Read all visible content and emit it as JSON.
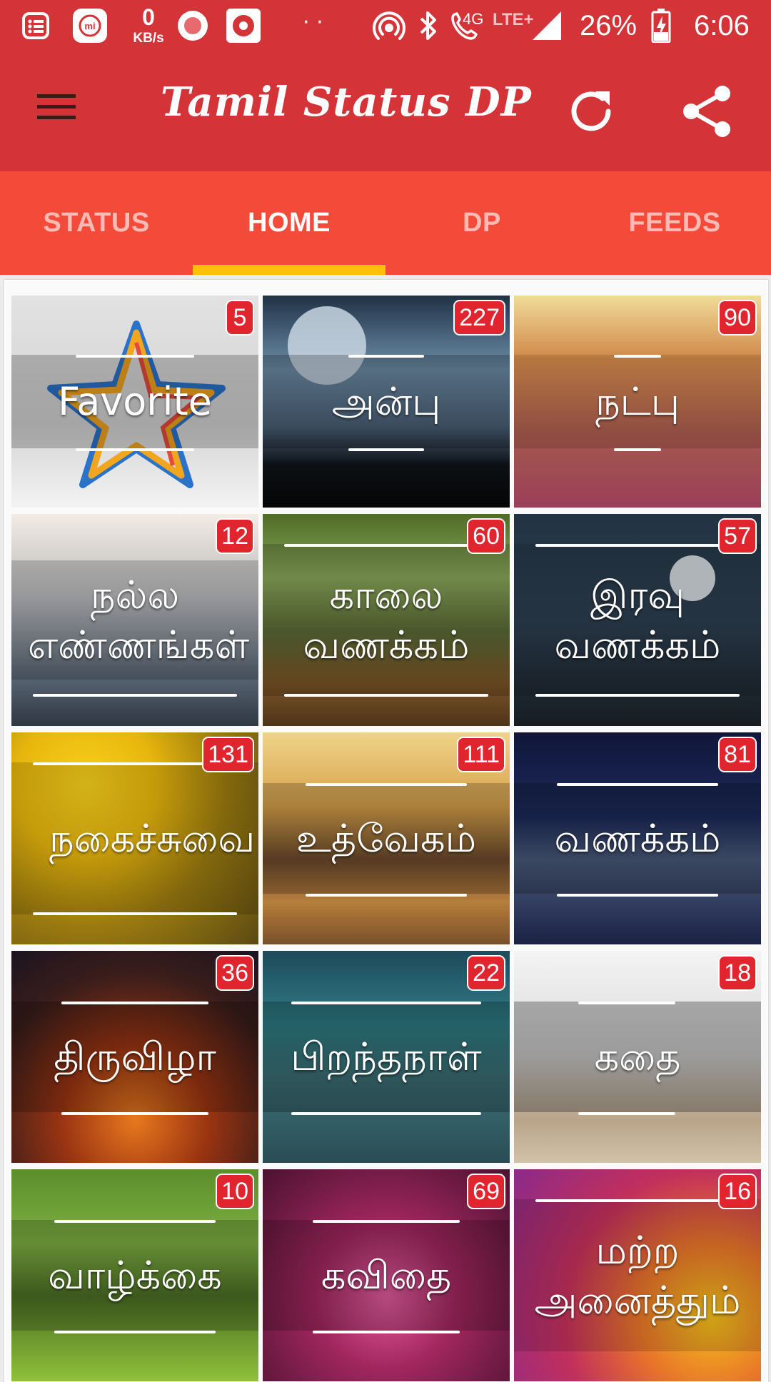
{
  "status_bar": {
    "net_speed_value": "0",
    "net_speed_unit": "KB/s",
    "dots": "· ·",
    "call_tag": "4G",
    "network": "LTE+",
    "battery": "26%",
    "time": "6:06",
    "icons": [
      "notification-list-icon",
      "mi-icon",
      "record-icon",
      "radio-icon",
      "hotspot-icon",
      "bluetooth-icon",
      "volte-call-icon",
      "signal-icon",
      "battery-charging-icon"
    ]
  },
  "app_bar": {
    "title": "Tamil Status DP",
    "color": "#d43438",
    "icons": [
      "menu-icon",
      "refresh-icon",
      "share-icon"
    ]
  },
  "tabs": [
    {
      "label": "STATUS",
      "active": false
    },
    {
      "label": "HOME",
      "active": true
    },
    {
      "label": "DP",
      "active": false
    },
    {
      "label": "FEEDS",
      "active": false
    }
  ],
  "tab_colors": {
    "bar": "#f44a3a",
    "indicator": "#ffc107"
  },
  "categories": [
    {
      "label": "Favorite",
      "count": "5"
    },
    {
      "label": "அன்பு",
      "count": "227"
    },
    {
      "label": "நட்பு",
      "count": "90"
    },
    {
      "label": "நல்ல எண்ணங்கள்",
      "count": "12"
    },
    {
      "label": "காலை வணக்கம்",
      "count": "60"
    },
    {
      "label": "இரவு வணக்கம்",
      "count": "57"
    },
    {
      "label": "நகைச்சுவை",
      "count": "131"
    },
    {
      "label": "உத்வேகம்",
      "count": "111"
    },
    {
      "label": "வணக்கம்",
      "count": "81"
    },
    {
      "label": "திருவிழா",
      "count": "36"
    },
    {
      "label": "பிறந்தநாள்",
      "count": "22"
    },
    {
      "label": "கதை",
      "count": "18"
    },
    {
      "label": "வாழ்க்கை",
      "count": "10"
    },
    {
      "label": "கவிதை",
      "count": "69"
    },
    {
      "label": "மற்ற அனைத்தும்",
      "count": "16"
    }
  ]
}
